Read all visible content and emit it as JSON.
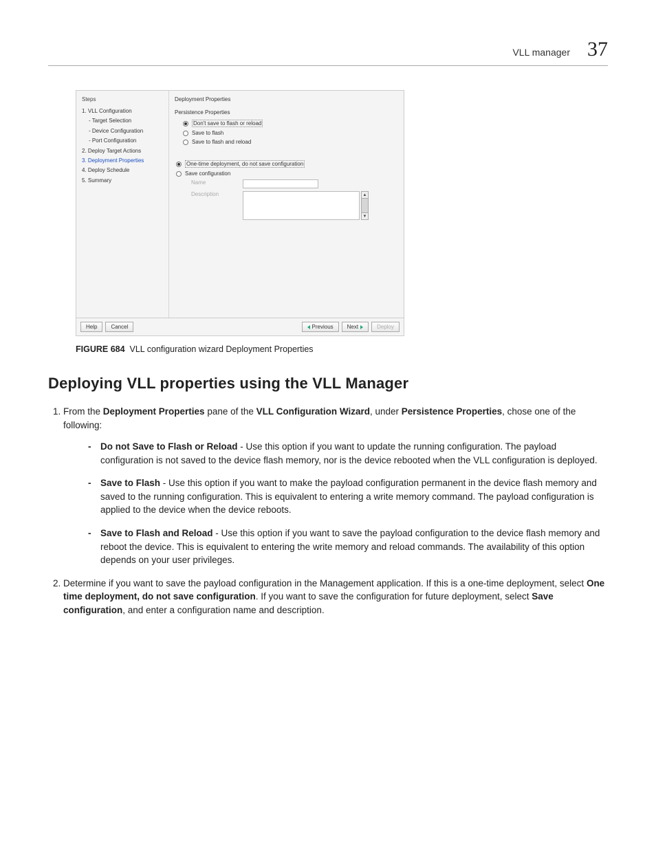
{
  "header": {
    "title": "VLL manager",
    "chapterNumber": "37"
  },
  "wizard": {
    "stepsTitle": "Steps",
    "steps": [
      {
        "label": "1. VLL Configuration"
      },
      {
        "label": "- Target Selection",
        "sub": true
      },
      {
        "label": "- Device Configuration",
        "sub": true
      },
      {
        "label": "- Port Configuration",
        "sub": true
      },
      {
        "label": "2. Deploy Target Actions"
      },
      {
        "label": "3. Deployment Properties",
        "sel": true
      },
      {
        "label": "4. Deploy Schedule"
      },
      {
        "label": "5. Summary"
      }
    ],
    "rightTitle": "Deployment Properties",
    "ppTitle": "Persistence Properties",
    "ppOptions": [
      {
        "label": "Don't save to flash or reload",
        "checked": true
      },
      {
        "label": "Save to flash",
        "checked": false
      },
      {
        "label": "Save to flash and reload",
        "checked": false
      }
    ],
    "saveOptions": [
      {
        "label": "One-time deployment, do not save configuration",
        "checked": true
      },
      {
        "label": "Save configuration",
        "checked": false
      }
    ],
    "fields": {
      "nameLabel": "Name",
      "descLabel": "Description"
    },
    "footer": {
      "help": "Help",
      "cancel": "Cancel",
      "previous": "Previous",
      "next": "Next",
      "deploy": "Deploy"
    }
  },
  "caption": {
    "prefix": "FIGURE 684",
    "text": "VLL configuration wizard Deployment Properties"
  },
  "section": {
    "heading": "Deploying VLL properties using the VLL Manager",
    "step1": {
      "pre": "From the ",
      "b1": "Deployment Properties",
      "mid1": " pane of the ",
      "b2": "VLL Configuration Wizard",
      "mid2": ", under ",
      "b3": "Persistence Properties",
      "post": ", chose one of the following:"
    },
    "bullets": [
      {
        "title": "Do not Save to Flash or Reload",
        "body": " - Use this option if you want to update the running configuration. The payload configuration is not saved to the device flash memory, nor is the device rebooted when the VLL configuration is deployed."
      },
      {
        "title": "Save to Flash",
        "body": " - Use this option if you want to make the payload configuration permanent in the device flash memory and saved to the running configuration. This is equivalent to entering a write memory command. The payload configuration is applied to the device when the device reboots."
      },
      {
        "title": "Save to Flash and Reload",
        "body": " - Use this option if you want to save the payload configuration to the device flash memory and reboot the device. This is equivalent to entering the write memory and reload commands. The availability of this option depends on your user privileges."
      }
    ],
    "step2": {
      "pre": "Determine if you want to save the payload configuration in the Management application. If this is a one-time deployment, select ",
      "b1": "One time deployment, do not save configuration",
      "mid1": ". If you want to save the configuration for future deployment, select ",
      "b2": "Save configuration",
      "post": ", and enter a configuration name and description."
    }
  }
}
